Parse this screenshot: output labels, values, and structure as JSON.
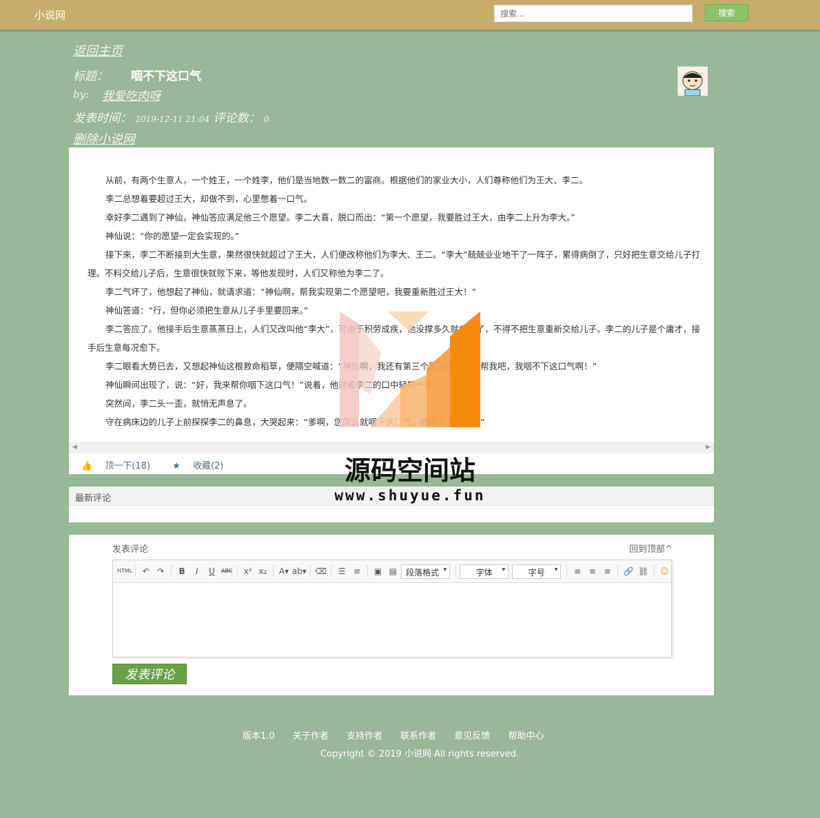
{
  "header": {
    "brand": "小说网",
    "search_placeholder": "搜索...",
    "search_button": "搜索"
  },
  "info": {
    "back_link": "返回主页",
    "title_label": "标题：",
    "title": "咽不下这口气",
    "by_label": "by:",
    "author": "我爱吃肉呀",
    "posted_label": "发表时间：",
    "posted_time": "2019-12-11 21:04",
    "comments_label": "评论数：",
    "comments_count": "0",
    "delete_link": "删除小说网"
  },
  "article": {
    "paragraphs": [
      "从前，有两个生意人，一个姓王，一个姓李，他们是当地数一数二的富商。根据他们的家业大小，人们尊称他们为王大、李二。",
      "李二总想着要超过王大，却做不到，心里憋着一口气。",
      "幸好李二遇到了神仙，神仙答应满足他三个愿望。李二大喜，脱口而出：“第一个愿望，我要胜过王大，由李二上升为李大。”",
      "神仙说：“你的愿望一定会实现的。”",
      "接下来，李二不断接到大生意，果然很快就超过了王大，人们便改称他们为李大、王二。“李大”兢兢业业地干了一阵子，累得病倒了，只好把生意交给儿子打理。不料交给儿子后，生意很快就败下来，等他发现时，人们又称他为李二了。",
      "李二气坏了，他想起了神仙，就请求道：“神仙啊，帮我实现第二个愿望吧，我要重新胜过王大！”",
      "神仙答道：“行，但你必须把生意从儿子手里要回来。”",
      "李二答应了。他接手后生意蒸蒸日上，人们又改叫他“李大”，可由于积劳成疾，他没撑多久就病倒了，不得不把生意重新交给儿子。李二的儿子是个庸才，接手后生意每况愈下。",
      "李二眼看大势已去，又想起神仙这根救命稻草，便隔空喊道：“神仙啊，我还有第三个愿望呢，再帮帮我吧，我咽不下这口气啊！”",
      "神仙瞬间出现了，说：“好，我来帮你咽下这口气！”说着，他对着李二的口中轻轻一吹。",
      "突然间，李二头一歪，就悄无声息了。",
      "守在病床边的儿子上前探探李二的鼻息，大哭起来：“爹啊，您怎么就咽下这口气，撒手人去了啊！”"
    ],
    "like_label": "顶一下(18)",
    "fav_label": "收藏(2)"
  },
  "comments": {
    "heading": "最新评论"
  },
  "form": {
    "label": "发表评论",
    "back_top": "回到顶部^",
    "toolbar": {
      "html": "HTML",
      "paragraph": "段落格式",
      "font": "字体",
      "size": "字号"
    },
    "submit": "发表评论"
  },
  "footer": {
    "links": [
      "版本1.0",
      "关于作者",
      "支持作者",
      "联系作者",
      "意见反馈",
      "帮助中心"
    ],
    "copyright": "Copyright © 2019 小说网 All rights reserved."
  },
  "watermark": {
    "name": "源码空间站",
    "url": "www.shuyue.fun"
  },
  "colors": {
    "background": "#98b897",
    "topbar": "#c8ac6c",
    "accent_green": "#8bc26a",
    "submit_green": "#6aa047",
    "watermark_orange": "#f7931e"
  }
}
